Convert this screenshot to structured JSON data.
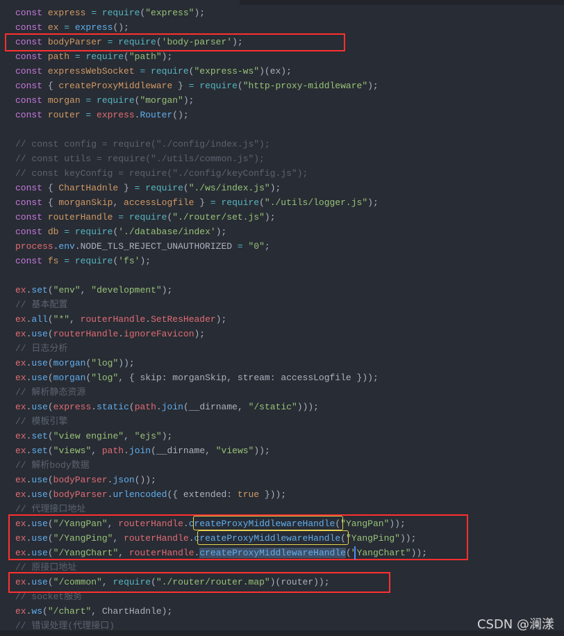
{
  "editor": {
    "lines": [
      [
        [
          "k",
          "const "
        ],
        [
          "v",
          "express"
        ],
        [
          "o",
          " = "
        ],
        [
          "o",
          "require"
        ],
        [
          "p",
          "("
        ],
        [
          "s",
          "\"express\""
        ],
        [
          "p",
          ");"
        ]
      ],
      [
        [
          "k",
          "const "
        ],
        [
          "v",
          "ex"
        ],
        [
          "o",
          " = "
        ],
        [
          "f",
          "express"
        ],
        [
          "p",
          "();"
        ]
      ],
      [
        [
          "k",
          "const "
        ],
        [
          "v",
          "bodyParser"
        ],
        [
          "o",
          " = "
        ],
        [
          "o",
          "require"
        ],
        [
          "p",
          "("
        ],
        [
          "s",
          "'body-parser'"
        ],
        [
          "p",
          ");"
        ]
      ],
      [
        [
          "k",
          "const "
        ],
        [
          "v",
          "path"
        ],
        [
          "o",
          " = "
        ],
        [
          "o",
          "require"
        ],
        [
          "p",
          "("
        ],
        [
          "s",
          "\"path\""
        ],
        [
          "p",
          ");"
        ]
      ],
      [
        [
          "k",
          "const "
        ],
        [
          "v",
          "expressWebSocket"
        ],
        [
          "o",
          " = "
        ],
        [
          "o",
          "require"
        ],
        [
          "p",
          "("
        ],
        [
          "s",
          "\"express-ws\""
        ],
        [
          "p",
          ")(ex);"
        ]
      ],
      [
        [
          "k",
          "const "
        ],
        [
          "p",
          "{ "
        ],
        [
          "v",
          "createProxyMiddleware"
        ],
        [
          "p",
          " }"
        ],
        [
          "o",
          " = "
        ],
        [
          "o",
          "require"
        ],
        [
          "p",
          "("
        ],
        [
          "s",
          "\"http-proxy-middleware\""
        ],
        [
          "p",
          ");"
        ]
      ],
      [
        [
          "k",
          "const "
        ],
        [
          "v",
          "morgan"
        ],
        [
          "o",
          " = "
        ],
        [
          "o",
          "require"
        ],
        [
          "p",
          "("
        ],
        [
          "s",
          "\"morgan\""
        ],
        [
          "p",
          ");"
        ]
      ],
      [
        [
          "k",
          "const "
        ],
        [
          "v",
          "router"
        ],
        [
          "o",
          " = "
        ],
        [
          "r",
          "express"
        ],
        [
          "p",
          "."
        ],
        [
          "f",
          "Router"
        ],
        [
          "p",
          "();"
        ]
      ],
      [],
      [
        [
          "c",
          "// const config = require(\"./config/index.js\");"
        ]
      ],
      [
        [
          "c",
          "// const utils = require(\"./utils/common.js\");"
        ]
      ],
      [
        [
          "c",
          "// const keyConfig = require(\"./config/keyConfig.js\");"
        ]
      ],
      [
        [
          "k",
          "const "
        ],
        [
          "p",
          "{ "
        ],
        [
          "v",
          "ChartHadnle"
        ],
        [
          "p",
          " }"
        ],
        [
          "o",
          " = "
        ],
        [
          "o",
          "require"
        ],
        [
          "p",
          "("
        ],
        [
          "s",
          "\"./ws/index.js\""
        ],
        [
          "p",
          ");"
        ]
      ],
      [
        [
          "k",
          "const "
        ],
        [
          "p",
          "{ "
        ],
        [
          "v",
          "morganSkip"
        ],
        [
          "p",
          ", "
        ],
        [
          "v",
          "accessLogfile"
        ],
        [
          "p",
          " }"
        ],
        [
          "o",
          " = "
        ],
        [
          "o",
          "require"
        ],
        [
          "p",
          "("
        ],
        [
          "s",
          "\"./utils/logger.js\""
        ],
        [
          "p",
          ");"
        ]
      ],
      [
        [
          "k",
          "const "
        ],
        [
          "v",
          "routerHandle"
        ],
        [
          "o",
          " = "
        ],
        [
          "o",
          "require"
        ],
        [
          "p",
          "("
        ],
        [
          "s",
          "\"./router/set.js\""
        ],
        [
          "p",
          ");"
        ]
      ],
      [
        [
          "k",
          "const "
        ],
        [
          "v",
          "db"
        ],
        [
          "o",
          " = "
        ],
        [
          "o",
          "require"
        ],
        [
          "p",
          "("
        ],
        [
          "s",
          "'./database/index'"
        ],
        [
          "p",
          ");"
        ]
      ],
      [
        [
          "r",
          "process"
        ],
        [
          "p",
          "."
        ],
        [
          "f",
          "env"
        ],
        [
          "p",
          ".NODE_TLS_REJECT_UNAUTHORIZED"
        ],
        [
          "o",
          " = "
        ],
        [
          "s",
          "\"0\""
        ],
        [
          "p",
          ";"
        ]
      ],
      [
        [
          "k",
          "const "
        ],
        [
          "v",
          "fs"
        ],
        [
          "o",
          " = "
        ],
        [
          "o",
          "require"
        ],
        [
          "p",
          "("
        ],
        [
          "s",
          "'fs'"
        ],
        [
          "p",
          ");"
        ]
      ],
      [],
      [
        [
          "r",
          "ex"
        ],
        [
          "p",
          "."
        ],
        [
          "f",
          "set"
        ],
        [
          "p",
          "("
        ],
        [
          "s",
          "\"env\""
        ],
        [
          "p",
          ", "
        ],
        [
          "s",
          "\"development\""
        ],
        [
          "p",
          ");"
        ]
      ],
      [
        [
          "c",
          "// 基本配置"
        ]
      ],
      [
        [
          "r",
          "ex"
        ],
        [
          "p",
          "."
        ],
        [
          "f",
          "all"
        ],
        [
          "p",
          "("
        ],
        [
          "s",
          "\"*\""
        ],
        [
          "p",
          ", "
        ],
        [
          "r",
          "routerHandle"
        ],
        [
          "p",
          "."
        ],
        [
          "r",
          "SetResHeader"
        ],
        [
          "p",
          ");"
        ]
      ],
      [
        [
          "r",
          "ex"
        ],
        [
          "p",
          "."
        ],
        [
          "f",
          "use"
        ],
        [
          "p",
          "("
        ],
        [
          "r",
          "routerHandle"
        ],
        [
          "p",
          "."
        ],
        [
          "r",
          "ignoreFavicon"
        ],
        [
          "p",
          ");"
        ]
      ],
      [
        [
          "c",
          "// 日志分析"
        ]
      ],
      [
        [
          "r",
          "ex"
        ],
        [
          "p",
          "."
        ],
        [
          "f",
          "use"
        ],
        [
          "p",
          "("
        ],
        [
          "f",
          "morgan"
        ],
        [
          "p",
          "("
        ],
        [
          "s",
          "\"log\""
        ],
        [
          "p",
          "));"
        ]
      ],
      [
        [
          "r",
          "ex"
        ],
        [
          "p",
          "."
        ],
        [
          "f",
          "use"
        ],
        [
          "p",
          "("
        ],
        [
          "f",
          "morgan"
        ],
        [
          "p",
          "("
        ],
        [
          "s",
          "\"log\""
        ],
        [
          "p",
          ", { skip: morganSkip, stream: accessLogfile }));"
        ]
      ],
      [
        [
          "c",
          "// 解析静态资源"
        ]
      ],
      [
        [
          "r",
          "ex"
        ],
        [
          "p",
          "."
        ],
        [
          "f",
          "use"
        ],
        [
          "p",
          "("
        ],
        [
          "r",
          "express"
        ],
        [
          "p",
          "."
        ],
        [
          "f",
          "static"
        ],
        [
          "p",
          "("
        ],
        [
          "r",
          "path"
        ],
        [
          "p",
          "."
        ],
        [
          "f",
          "join"
        ],
        [
          "p",
          "(__dirname, "
        ],
        [
          "s",
          "\"/static\""
        ],
        [
          "p",
          ")));"
        ]
      ],
      [
        [
          "c",
          "// 模板引擎"
        ]
      ],
      [
        [
          "r",
          "ex"
        ],
        [
          "p",
          "."
        ],
        [
          "f",
          "set"
        ],
        [
          "p",
          "("
        ],
        [
          "s",
          "\"view engine\""
        ],
        [
          "p",
          ", "
        ],
        [
          "s",
          "\"ejs\""
        ],
        [
          "p",
          ");"
        ]
      ],
      [
        [
          "r",
          "ex"
        ],
        [
          "p",
          "."
        ],
        [
          "f",
          "set"
        ],
        [
          "p",
          "("
        ],
        [
          "s",
          "\"views\""
        ],
        [
          "p",
          ", "
        ],
        [
          "r",
          "path"
        ],
        [
          "p",
          "."
        ],
        [
          "f",
          "join"
        ],
        [
          "p",
          "(__dirname, "
        ],
        [
          "s",
          "\"views\""
        ],
        [
          "p",
          "));"
        ]
      ],
      [
        [
          "c",
          "// 解析body数据"
        ]
      ],
      [
        [
          "r",
          "ex"
        ],
        [
          "p",
          "."
        ],
        [
          "f",
          "use"
        ],
        [
          "p",
          "("
        ],
        [
          "r",
          "bodyParser"
        ],
        [
          "p",
          "."
        ],
        [
          "f",
          "json"
        ],
        [
          "p",
          "());"
        ]
      ],
      [
        [
          "r",
          "ex"
        ],
        [
          "p",
          "."
        ],
        [
          "f",
          "use"
        ],
        [
          "p",
          "("
        ],
        [
          "r",
          "bodyParser"
        ],
        [
          "p",
          "."
        ],
        [
          "f",
          "urlencoded"
        ],
        [
          "p",
          "({ extended: "
        ],
        [
          "v",
          "true"
        ],
        [
          "p",
          " }));"
        ]
      ],
      [
        [
          "c",
          "// 代理接口地址"
        ]
      ],
      [
        [
          "r",
          "ex"
        ],
        [
          "p",
          "."
        ],
        [
          "f",
          "use"
        ],
        [
          "p",
          "("
        ],
        [
          "s",
          "\"/YangPan\""
        ],
        [
          "p",
          ", "
        ],
        [
          "r",
          "routerHandle"
        ],
        [
          "p",
          "."
        ],
        [
          "f",
          "createProxyMiddlewareHandle"
        ],
        [
          "p",
          "("
        ],
        [
          "s",
          "\"YangPan\""
        ],
        [
          "p",
          "));"
        ]
      ],
      [
        [
          "r",
          "ex"
        ],
        [
          "p",
          "."
        ],
        [
          "f",
          "use"
        ],
        [
          "p",
          "("
        ],
        [
          "s",
          "\"/YangPing\""
        ],
        [
          "p",
          ", "
        ],
        [
          "r",
          "routerHandle"
        ],
        [
          "p",
          "."
        ],
        [
          "f",
          "createProxyMiddlewareHandle"
        ],
        [
          "p",
          "("
        ],
        [
          "s",
          "\"YangPing\""
        ],
        [
          "p",
          "));"
        ]
      ],
      [
        [
          "r",
          "ex"
        ],
        [
          "p",
          "."
        ],
        [
          "f",
          "use"
        ],
        [
          "p",
          "("
        ],
        [
          "s",
          "\"/YangChart\""
        ],
        [
          "p",
          ", "
        ],
        [
          "r",
          "routerHandle"
        ],
        [
          "p",
          "."
        ],
        [
          "f sel",
          "createProxyMiddlewareHandle"
        ],
        [
          "p",
          "("
        ],
        [
          "s",
          "\"YangChart\""
        ],
        [
          "p",
          "));"
        ]
      ],
      [
        [
          "c",
          "// 原接口地址"
        ]
      ],
      [
        [
          "r",
          "ex"
        ],
        [
          "p",
          "."
        ],
        [
          "f",
          "use"
        ],
        [
          "p",
          "("
        ],
        [
          "s",
          "\"/common\""
        ],
        [
          "p",
          ", "
        ],
        [
          "o",
          "require"
        ],
        [
          "p",
          "("
        ],
        [
          "s",
          "\"./router/router.map\""
        ],
        [
          "p",
          ")(router));"
        ]
      ],
      [
        [
          "c",
          "// socket服务"
        ]
      ],
      [
        [
          "r",
          "ex"
        ],
        [
          "p",
          "."
        ],
        [
          "f",
          "ws"
        ],
        [
          "p",
          "("
        ],
        [
          "s",
          "\"/chart\""
        ],
        [
          "p",
          ", ChartHadnle);"
        ]
      ],
      [
        [
          "c",
          "// 错误处理(代理接口)"
        ]
      ]
    ]
  },
  "watermark": "CSDN @澜漾",
  "colors": {
    "background": "#282c34",
    "highlight_box": "#ff3030",
    "yellow_box": "#e8d44d"
  }
}
